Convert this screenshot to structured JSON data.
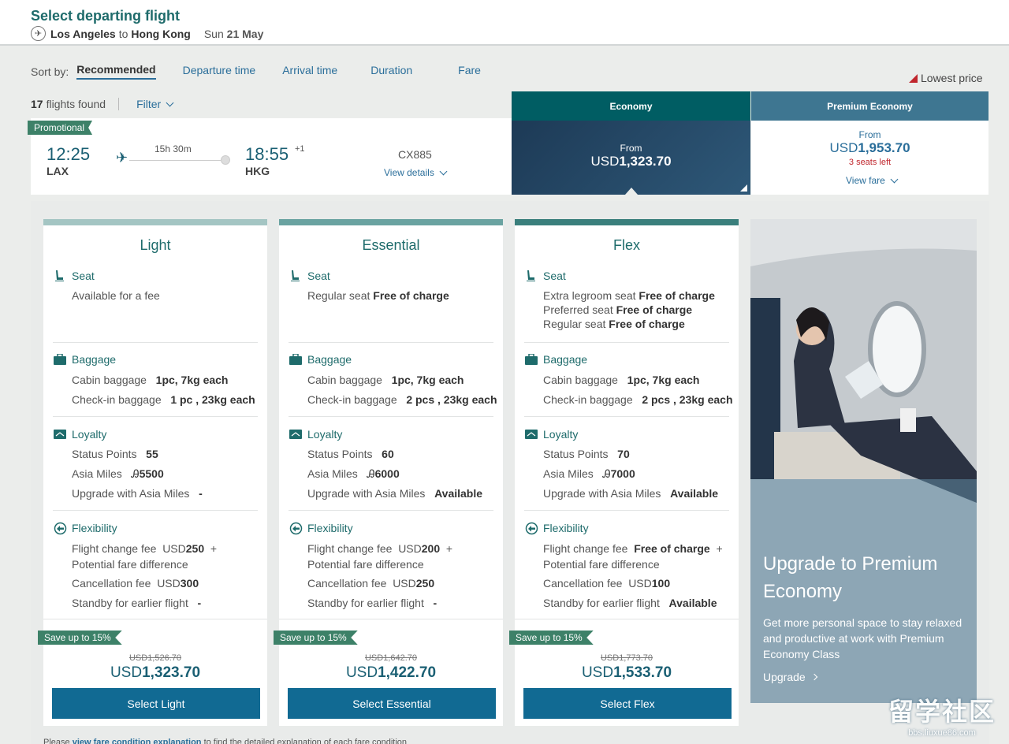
{
  "header": {
    "title": "Select departing flight",
    "from_city": "Los Angeles",
    "to_word": "to",
    "to_city": "Hong Kong",
    "date_prefix": "Sun",
    "date": "21 May"
  },
  "sort": {
    "label": "Sort by:",
    "options": [
      "Recommended",
      "Departure time",
      "Arrival time",
      "Duration",
      "Fare"
    ],
    "active": "Recommended"
  },
  "legend": {
    "lowest_price": "Lowest price",
    "lowest_price_color": "#c0262d"
  },
  "results": {
    "count": "17",
    "count_label": "flights found",
    "filter_label": "Filter"
  },
  "cabins": {
    "economy": "Economy",
    "premium_economy": "Premium Economy"
  },
  "flight": {
    "promo_tag": "Promotional",
    "dep_time": "12:25",
    "dep_code": "LAX",
    "arr_time": "18:55",
    "arr_day_offset": "+1",
    "arr_code": "HKG",
    "duration": "15h 30m",
    "flight_number": "CX885",
    "view_details": "View details"
  },
  "economy_price": {
    "from": "From",
    "currency": "USD",
    "amount": "1,323.70"
  },
  "premium_price": {
    "from": "From",
    "currency": "USD",
    "amount": "1,953.70",
    "seats_left": "3 seats left",
    "view_fare": "View fare"
  },
  "fares": [
    {
      "name": "Light",
      "bar_color": "#a4c5c3",
      "seat_label": "Seat",
      "seat_lines": [
        {
          "text": "Available for a fee",
          "bold": ""
        }
      ],
      "baggage_label": "Baggage",
      "cabin_bag": "Cabin baggage",
      "cabin_bag_val": "1pc, 7kg each",
      "checkin_bag": "Check-in baggage",
      "checkin_bag_val": "1 pc , 23kg each",
      "loyalty_label": "Loyalty",
      "status_points": "Status Points",
      "status_points_val": "55",
      "asia_miles": "Asia Miles",
      "asia_miles_val": "5500",
      "upgrade": "Upgrade with Asia Miles",
      "upgrade_val": "-",
      "flex_label": "Flexibility",
      "change_fee": "Flight change fee",
      "change_fee_cur": "USD",
      "change_fee_val": "250",
      "plus": "+",
      "fare_diff": "Potential fare difference",
      "cancel_fee": "Cancellation fee",
      "cancel_fee_cur": "USD",
      "cancel_fee_val": "300",
      "standby": "Standby for earlier flight",
      "standby_val": "-",
      "save_tag": "Save up to 15%",
      "old_price": "USD1,526.70",
      "price_currency": "USD",
      "price_amount": "1,323.70",
      "button": "Select Light"
    },
    {
      "name": "Essential",
      "bar_color": "#6aa3a1",
      "seat_label": "Seat",
      "seat_lines": [
        {
          "text": "Regular seat",
          "bold": "Free of charge"
        }
      ],
      "baggage_label": "Baggage",
      "cabin_bag": "Cabin baggage",
      "cabin_bag_val": "1pc, 7kg each",
      "checkin_bag": "Check-in baggage",
      "checkin_bag_val": "2 pcs , 23kg each",
      "loyalty_label": "Loyalty",
      "status_points": "Status Points",
      "status_points_val": "60",
      "asia_miles": "Asia Miles",
      "asia_miles_val": "6000",
      "upgrade": "Upgrade with Asia Miles",
      "upgrade_val": "Available",
      "flex_label": "Flexibility",
      "change_fee": "Flight change fee",
      "change_fee_cur": "USD",
      "change_fee_val": "200",
      "plus": "+",
      "fare_diff": "Potential fare difference",
      "cancel_fee": "Cancellation fee",
      "cancel_fee_cur": "USD",
      "cancel_fee_val": "250",
      "standby": "Standby for earlier flight",
      "standby_val": "-",
      "save_tag": "Save up to 15%",
      "old_price": "USD1,642.70",
      "price_currency": "USD",
      "price_amount": "1,422.70",
      "button": "Select Essential"
    },
    {
      "name": "Flex",
      "bar_color": "#3a7f7c",
      "seat_label": "Seat",
      "seat_lines": [
        {
          "text": "Extra legroom seat",
          "bold": "Free of charge"
        },
        {
          "text": "Preferred seat",
          "bold": "Free of charge"
        },
        {
          "text": "Regular seat",
          "bold": "Free of charge"
        }
      ],
      "baggage_label": "Baggage",
      "cabin_bag": "Cabin baggage",
      "cabin_bag_val": "1pc, 7kg each",
      "checkin_bag": "Check-in baggage",
      "checkin_bag_val": "2 pcs , 23kg each",
      "loyalty_label": "Loyalty",
      "status_points": "Status Points",
      "status_points_val": "70",
      "asia_miles": "Asia Miles",
      "asia_miles_val": "7000",
      "upgrade": "Upgrade with Asia Miles",
      "upgrade_val": "Available",
      "flex_label": "Flexibility",
      "change_fee": "Flight change fee",
      "change_fee_cur": "",
      "change_fee_val": "Free of charge",
      "plus": "+",
      "fare_diff": "Potential fare difference",
      "cancel_fee": "Cancellation fee",
      "cancel_fee_cur": "USD",
      "cancel_fee_val": "100",
      "standby": "Standby for earlier flight",
      "standby_val": "Available",
      "save_tag": "Save up to 15%",
      "old_price": "USD1,773.70",
      "price_currency": "USD",
      "price_amount": "1,533.70",
      "button": "Select Flex"
    }
  ],
  "upgrade_promo": {
    "title": "Upgrade to Premium Economy",
    "text": "Get more personal space to stay relaxed and productive at work with Premium Economy Class",
    "link": "Upgrade"
  },
  "footnote": {
    "prefix": "Please",
    "link": "view fare condition explanation",
    "suffix": "to find the detailed explanation of each fare condition"
  },
  "watermark": {
    "big": "留学社区",
    "small": "bbs.liuxue86.com"
  },
  "icons": {
    "route": "plane-circle-icon",
    "flight": "plane-icon",
    "seat": "seat-icon",
    "baggage": "baggage-icon",
    "loyalty": "loyalty-card-icon",
    "flexibility": "flexibility-icon"
  }
}
